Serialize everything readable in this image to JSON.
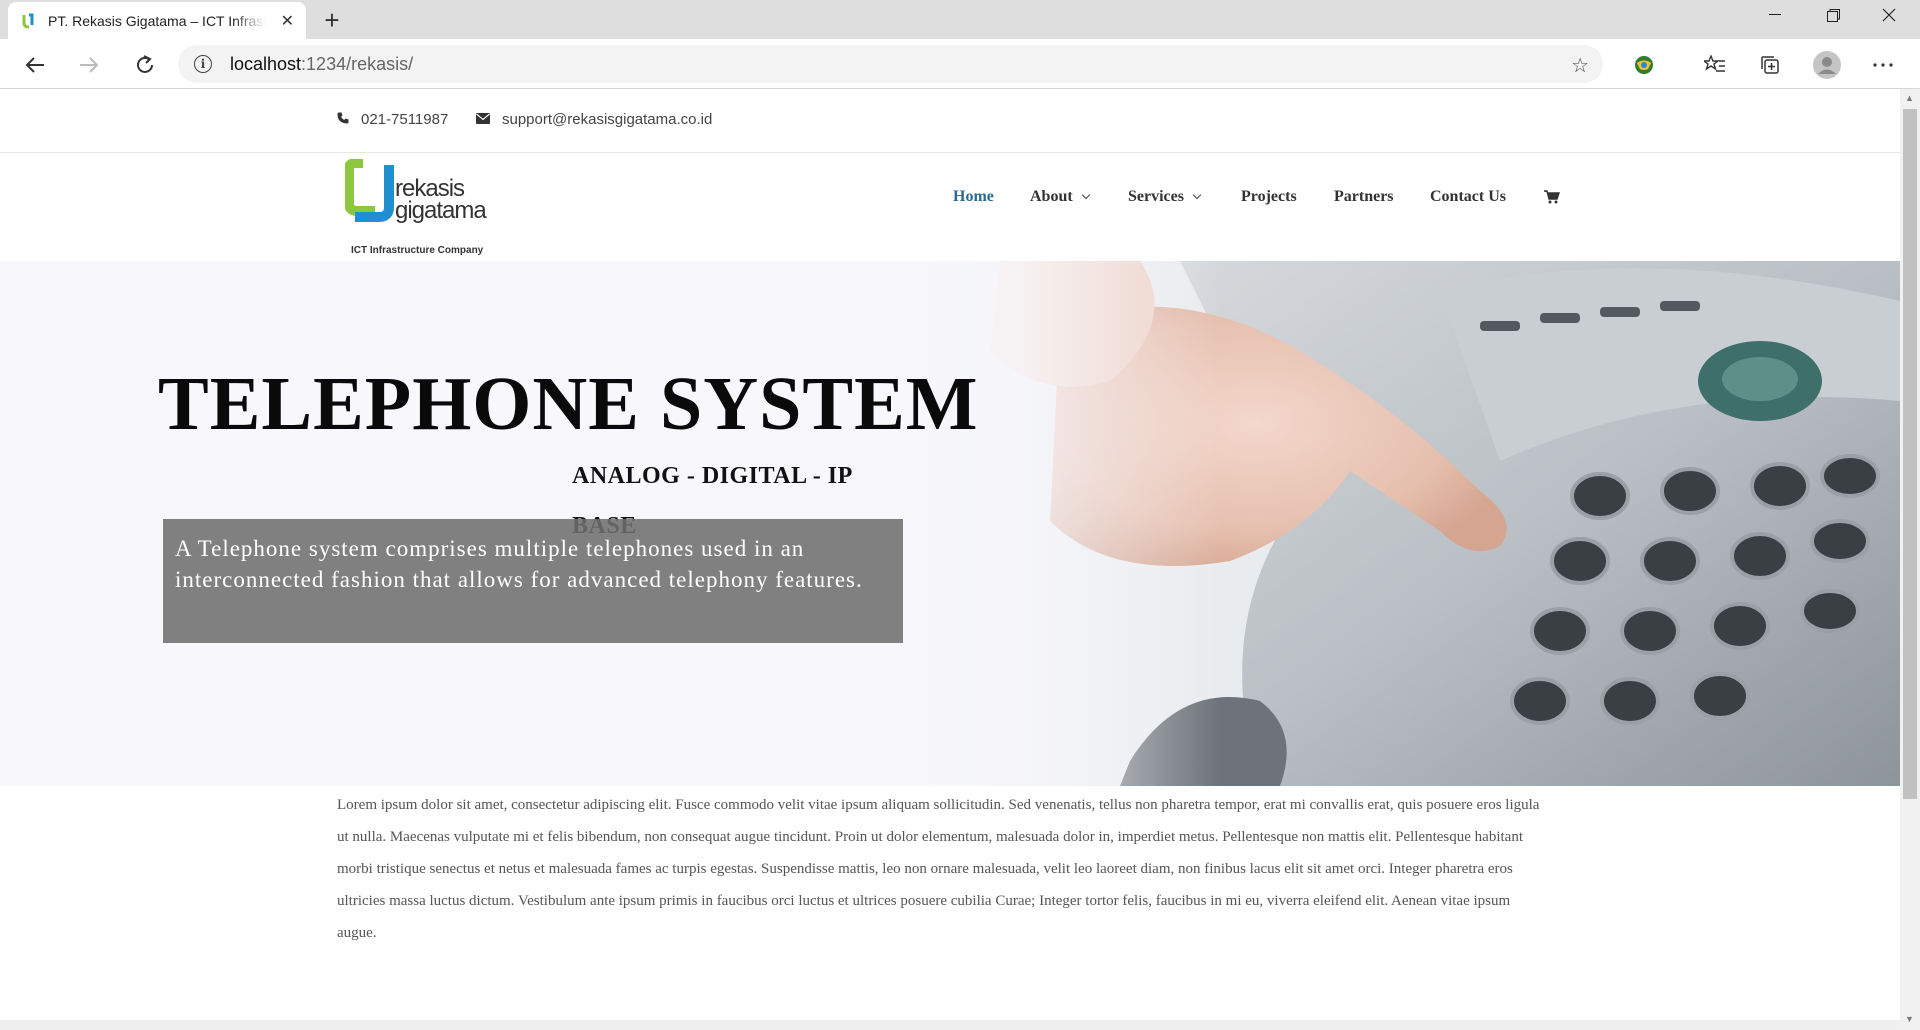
{
  "browser": {
    "tab_title": "PT. Rekasis Gigatama – ICT Infrastructure Company",
    "address_host": "localhost",
    "address_path": ":1234/rekasis/",
    "icons": [
      "back-icon",
      "forward-icon",
      "refresh-icon",
      "info-icon",
      "star-icon",
      "extension-icon",
      "favorites-icon",
      "collections-icon",
      "profile-icon",
      "more-icon"
    ]
  },
  "topbar": {
    "phone": "021-7511987",
    "email": "support@rekasisgigatama.co.id"
  },
  "logo": {
    "word1": "rekasis",
    "word2": "gigatama",
    "tagline": "ICT Infrastructure Company",
    "colors": {
      "green": "#8dc63f",
      "blue": "#1f8fd0"
    }
  },
  "nav": {
    "home": "Home",
    "about": "About",
    "services": "Services",
    "projects": "Projects",
    "partners": "Partners",
    "contact": "Contact Us",
    "active_color": "#2b6b8f"
  },
  "hero": {
    "title": "TELEPHONE SYSTEM",
    "subtitle": "ANALOG - DIGITAL - IP BASE",
    "description": "A Telephone system comprises multiple telephones used in an interconnected fashion that allows for advanced telephony features."
  },
  "content": {
    "paragraph": "Lorem ipsum dolor sit amet, consectetur adipiscing elit. Fusce commodo velit vitae ipsum aliquam sollicitudin. Sed venenatis, tellus non pharetra tempor, erat mi convallis erat, quis posuere eros ligula ut nulla. Maecenas vulputate mi et felis bibendum, non consequat augue tincidunt. Proin ut dolor elementum, malesuada dolor in, imperdiet metus. Pellentesque non mattis elit. Pellentesque habitant morbi tristique senectus et netus et malesuada fames ac turpis egestas. Suspendisse mattis, leo non ornare malesuada, velit leo laoreet diam, non finibus lacus elit sit amet orci. Integer pharetra eros ultricies massa luctus dictum. Vestibulum ante ipsum primis in faucibus orci luctus et ultrices posuere cubilia Curae; Integer tortor felis, faucibus in mi eu, viverra eleifend elit. Aenean vitae ipsum augue."
  }
}
